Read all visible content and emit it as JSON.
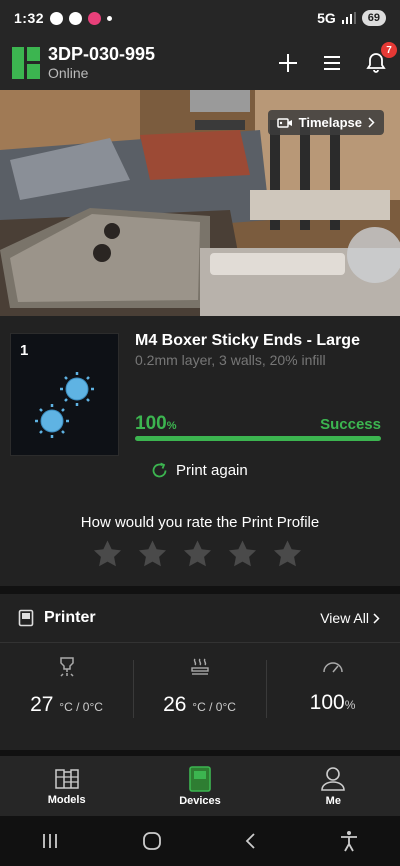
{
  "status_bar": {
    "time": "1:32",
    "network": "5G",
    "battery": "69"
  },
  "header": {
    "device_name": "3DP-030-995",
    "device_status": "Online",
    "notification_count": "7"
  },
  "camera": {
    "timelapse_label": "Timelapse"
  },
  "job": {
    "plate_number": "1",
    "title": "M4 Boxer Sticky Ends - Large",
    "details": "0.2mm layer, 3 walls, 20% infill",
    "progress_value": "100",
    "progress_unit": "%",
    "progress_fraction": 1.0,
    "result": "Success",
    "print_again_label": "Print again",
    "rating_prompt": "How would you rate the Print Profile",
    "rating_stars": 5,
    "rating_value": 0
  },
  "printer": {
    "title": "Printer",
    "view_all_label": "View All",
    "stats": [
      {
        "icon": "nozzle-icon",
        "value": "27",
        "unit": "°C / 0°C"
      },
      {
        "icon": "heatbed-icon",
        "value": "26",
        "unit": "°C / 0°C"
      },
      {
        "icon": "speed-gauge-icon",
        "value": "100",
        "unit": "%"
      }
    ]
  },
  "nav": {
    "items": [
      {
        "label": "Models",
        "icon": "models-icon"
      },
      {
        "label": "Devices",
        "icon": "devices-icon",
        "active": true
      },
      {
        "label": "Me",
        "icon": "profile-icon"
      }
    ]
  },
  "colors": {
    "accent": "#3cb550",
    "badge": "#e53935",
    "background": "#222222"
  }
}
